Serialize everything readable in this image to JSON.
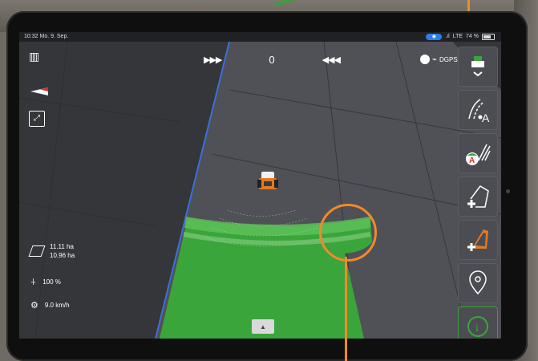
{
  "status": {
    "time": "10:32",
    "date": "Mo. 9. Sep.",
    "network": "LTE",
    "battery": "74 %"
  },
  "topbar": {
    "left_arrows": "▶▶▶",
    "count": "0",
    "right_arrows": "◀◀◀"
  },
  "gps": {
    "label": "DGPS"
  },
  "stats": {
    "area_total": "11.11 ha",
    "area_worked": "10.96 ha",
    "width_pct": "100 %",
    "speed": "9.0 km/h"
  },
  "sidebar": [
    {
      "icon": "tractor-view-icon"
    },
    {
      "icon": "guidance-line-a-icon"
    },
    {
      "icon": "headland-guidance-icon"
    },
    {
      "icon": "add-boundary-icon"
    },
    {
      "icon": "add-field-icon"
    },
    {
      "icon": "location-pin-icon"
    },
    {
      "icon": "info-icon"
    }
  ],
  "colors": {
    "field_green": "#3aa53a",
    "background": "#3a3b3f",
    "accent_orange": "#f08a2c"
  }
}
